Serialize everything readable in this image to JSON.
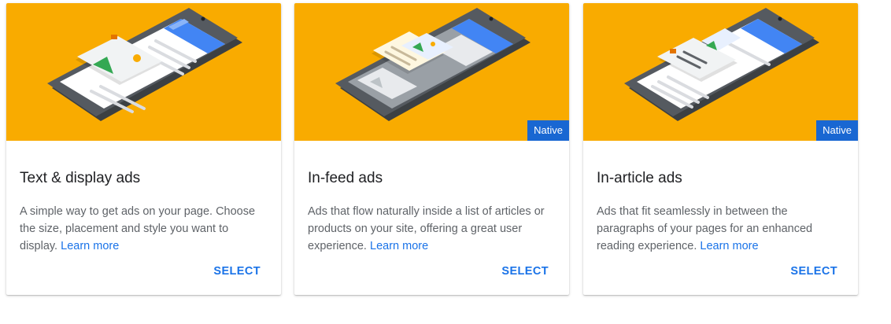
{
  "colors": {
    "hero_background": "#f9ab00",
    "badge_background": "#1967d2",
    "link": "#1a73e8",
    "title": "#202124",
    "body_text": "#5f6368"
  },
  "cards": [
    {
      "illustration": "phone-display-ad-illustration",
      "badge": "",
      "title": "Text & display ads",
      "description": "A simple way to get ads on your page. Choose the size, placement and style you want to display.",
      "learn_more": "Learn more",
      "action": "SELECT"
    },
    {
      "illustration": "phone-in-feed-ad-illustration",
      "badge": "Native",
      "title": "In-feed ads",
      "description": "Ads that flow naturally inside a list of articles or products on your site, offering a great user experience.",
      "learn_more": "Learn more",
      "action": "SELECT"
    },
    {
      "illustration": "phone-in-article-ad-illustration",
      "badge": "Native",
      "title": "In-article ads",
      "description": "Ads that fit seamlessly in between the paragraphs of your pages for an enhanced reading experience.",
      "learn_more": "Learn more",
      "action": "SELECT"
    }
  ]
}
